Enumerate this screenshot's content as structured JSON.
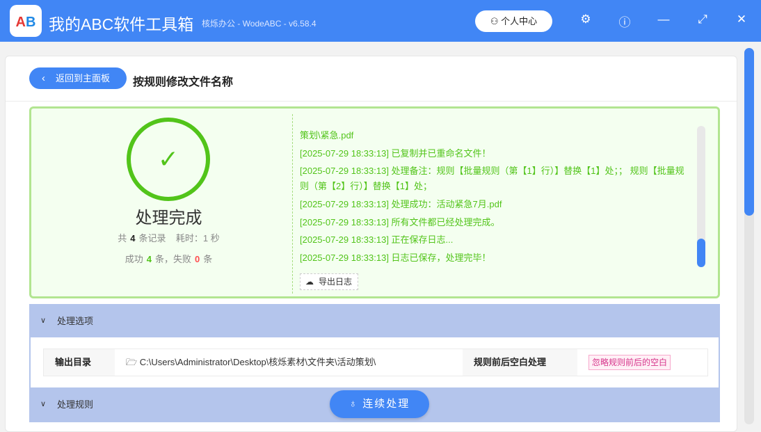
{
  "app": {
    "title": "我的ABC软件工具箱",
    "subtitle": "核烁办公 - WodeABC - v6.58.4",
    "logo_text": "AB",
    "user_center": "个人中心"
  },
  "page": {
    "back_label": "返回到主面板",
    "title": "按规则修改文件名称"
  },
  "result": {
    "status": "处理完成",
    "total_prefix": "共",
    "total": "4",
    "total_suffix": "条记录",
    "time_label": "耗时：",
    "time": "1",
    "time_unit": "秒",
    "success_label": "成功",
    "success": "4",
    "fail_label": "条，失败",
    "fail": "0",
    "fail_suffix": "条",
    "export_label": "导出日志",
    "log": [
      "策划\\紧急.pdf",
      "[2025-07-29 18:33:13] 已复制并已重命名文件！",
      "[2025-07-29 18:33:13] 处理备注：规则【批量规则（第【1】行）】替换【1】处；； 规则【批量规则（第【2】行）】替换【1】处；",
      "[2025-07-29 18:33:13] 处理成功：活动紧急7月.pdf",
      "[2025-07-29 18:33:13] 所有文件都已经处理完成。",
      "[2025-07-29 18:33:13] 正在保存日志...",
      "[2025-07-29 18:33:13] 日志已保存，处理完毕！"
    ]
  },
  "options": {
    "header": "处理选项",
    "output_dir_label": "输出目录",
    "output_dir": "C:\\Users\\Administrator\\Desktop\\核烁素材\\文件夹\\活动策划\\",
    "trim_label": "规则前后空白处理",
    "trim_value": "忽略规则前后的空白"
  },
  "rules": {
    "header": "处理规则"
  },
  "continue_label": "连续处理",
  "colors": {
    "accent": "#4186f5",
    "success": "#52c41a",
    "fail": "#ff4d4f",
    "section": "#b4c5ec"
  }
}
